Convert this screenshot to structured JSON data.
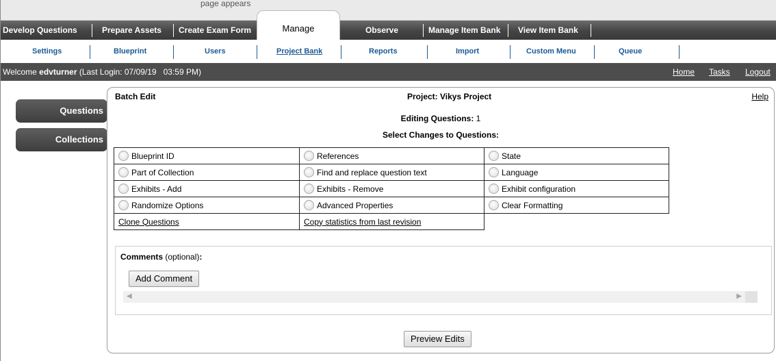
{
  "top_tabs": [
    {
      "label": "Develop Questions"
    },
    {
      "label": "Prepare Assets"
    },
    {
      "label": "Create Exam Form"
    },
    {
      "label": "Manage"
    },
    {
      "label": "Observe"
    },
    {
      "label": "Manage Item Bank"
    },
    {
      "label": "View Item Bank"
    }
  ],
  "top_strip_text": "page appears",
  "sub_tabs": [
    {
      "label": "Settings"
    },
    {
      "label": "Blueprint"
    },
    {
      "label": "Users"
    },
    {
      "label": "Project Bank"
    },
    {
      "label": "Reports"
    },
    {
      "label": "Import"
    },
    {
      "label": "Custom Menu"
    },
    {
      "label": "Queue"
    }
  ],
  "welcome": {
    "prefix": "Welcome ",
    "user": "edvturner",
    "last_login": "(Last Login: 07/09/19   03:59 PM)",
    "links": {
      "home": "Home",
      "tasks": "Tasks",
      "logout": "Logout"
    }
  },
  "left_nav": {
    "questions": "Questions",
    "collections": "Collections"
  },
  "panel": {
    "title": "Batch Edit",
    "project": "Project: Vikys Project",
    "help": "Help",
    "editing_label": "Editing Questions:",
    "editing_count": " 1",
    "select_label": "Select Changes to Questions:"
  },
  "options": [
    [
      "Blueprint ID",
      "References",
      "State"
    ],
    [
      "Part of Collection",
      "Find and replace question text",
      "Language"
    ],
    [
      "Exhibits - Add",
      "Exhibits - Remove",
      "Exhibit configuration"
    ],
    [
      "Randomize Options",
      "Advanced Properties",
      "Clear Formatting"
    ]
  ],
  "links": {
    "clone": "Clone Questions",
    "copy_stats": "Copy statistics from last revision"
  },
  "comments": {
    "label": "Comments",
    "optional": " (optional)",
    "colon": ":",
    "add_button": "Add Comment",
    "scroll_left": "◀",
    "scroll_right": "▶"
  },
  "preview_button": "Preview Edits"
}
